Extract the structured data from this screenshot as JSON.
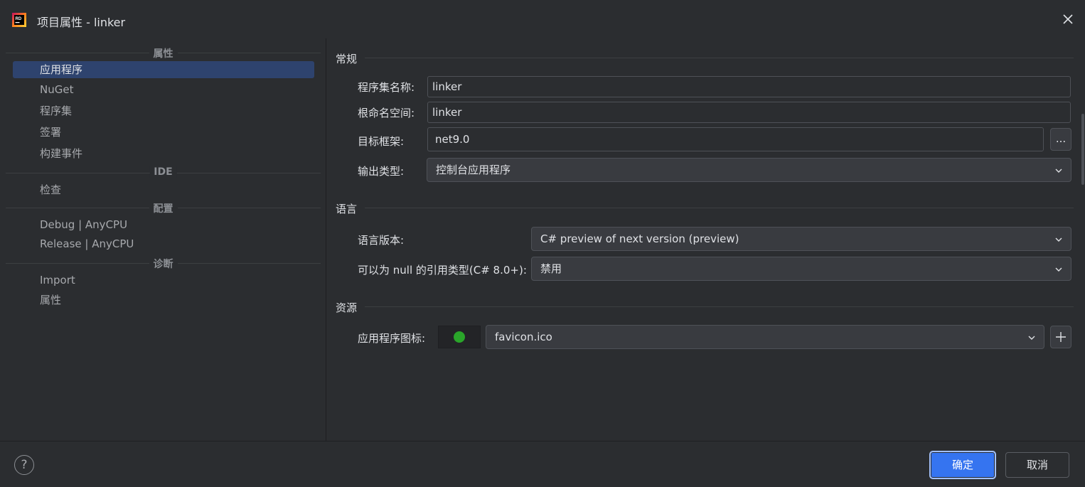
{
  "window": {
    "title": "项目属性 - linker",
    "icon": "rider-app-icon",
    "close_icon": "close-icon"
  },
  "sidebar": {
    "sections": [
      {
        "header": "属性",
        "items": [
          "应用程序",
          "NuGet",
          "程序集",
          "签署",
          "构建事件"
        ]
      },
      {
        "header": "IDE",
        "items": [
          "检查"
        ]
      },
      {
        "header": "配置",
        "items": [
          "Debug | AnyCPU",
          "Release | AnyCPU"
        ]
      },
      {
        "header": "诊断",
        "items": [
          "Import",
          "属性"
        ]
      }
    ],
    "active_item": "应用程序"
  },
  "general": {
    "title": "常规",
    "assembly_name_label": "程序集名称:",
    "assembly_name_value": "linker",
    "root_namespace_label": "根命名空间:",
    "root_namespace_value": "linker",
    "target_framework_label": "目标框架:",
    "target_framework_value": "net9.0",
    "browse_label": "...",
    "output_type_label": "输出类型:",
    "output_type_value": "控制台应用程序"
  },
  "language": {
    "title": "语言",
    "version_label": "语言版本:",
    "version_value": "C# preview of next version (preview)",
    "nullable_label": "可以为 null 的引用类型(C# 8.0+):",
    "nullable_value": "禁用"
  },
  "resources": {
    "title": "资源",
    "app_icon_label": "应用程序图标:",
    "app_icon_value": "favicon.ico",
    "add_icon": "plus-icon"
  },
  "footer": {
    "help_label": "?",
    "ok_label": "确定",
    "cancel_label": "取消"
  },
  "colors": {
    "accent": "#3574f0",
    "selection": "#2e436e",
    "background": "#2b2d30"
  }
}
